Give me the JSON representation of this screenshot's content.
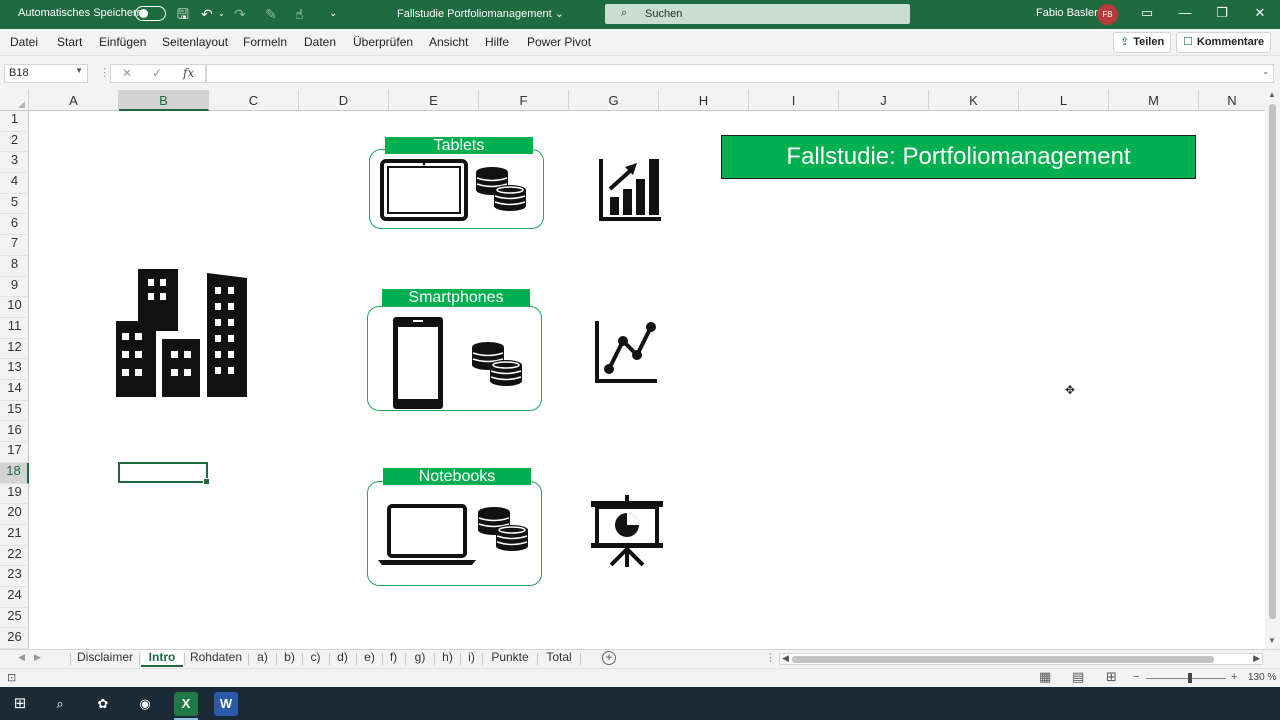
{
  "titlebar": {
    "autosave_label": "Automatisches Speichern",
    "document_title": "Fallstudie Portfoliomanagement",
    "search_placeholder": "Suchen",
    "user_name": "Fabio Basler",
    "user_initials": "FB"
  },
  "ribbon": {
    "menu": [
      "Datei",
      "Start",
      "Einfügen",
      "Seitenlayout",
      "Formeln",
      "Daten",
      "Überprüfen",
      "Ansicht",
      "Hilfe",
      "Power Pivot"
    ],
    "share_label": "Teilen",
    "comments_label": "Kommentare"
  },
  "formula_bar": {
    "name_box": "B18",
    "fx_label": "fx",
    "formula": ""
  },
  "columns": [
    "A",
    "B",
    "C",
    "D",
    "E",
    "F",
    "G",
    "H",
    "I",
    "J",
    "K",
    "L",
    "M",
    "N"
  ],
  "rows": [
    "1",
    "2",
    "3",
    "4",
    "5",
    "6",
    "7",
    "8",
    "9",
    "10",
    "11",
    "12",
    "13",
    "14",
    "15",
    "16",
    "17",
    "18",
    "19",
    "20",
    "21",
    "22",
    "23",
    "24",
    "25",
    "26"
  ],
  "selected_cell": {
    "column": "B",
    "row": "18"
  },
  "sheet": {
    "cards": {
      "tablets": "Tablets",
      "smartphones": "Smartphones",
      "notebooks": "Notebooks"
    },
    "banner_title": "Fallstudie: Portfoliomanagement"
  },
  "sheet_tabs": [
    "Disclaimer",
    "Intro",
    "Rohdaten",
    "a)",
    "b)",
    "c)",
    "d)",
    "e)",
    "f)",
    "g)",
    "h)",
    "i)",
    "Punkte",
    "Total"
  ],
  "active_sheet": "Intro",
  "statusbar": {
    "zoom": "130 %"
  },
  "colors": {
    "excel_green": "#1e6b3f",
    "accent_green": "#00b050",
    "taskbar": "#1c2a36"
  }
}
